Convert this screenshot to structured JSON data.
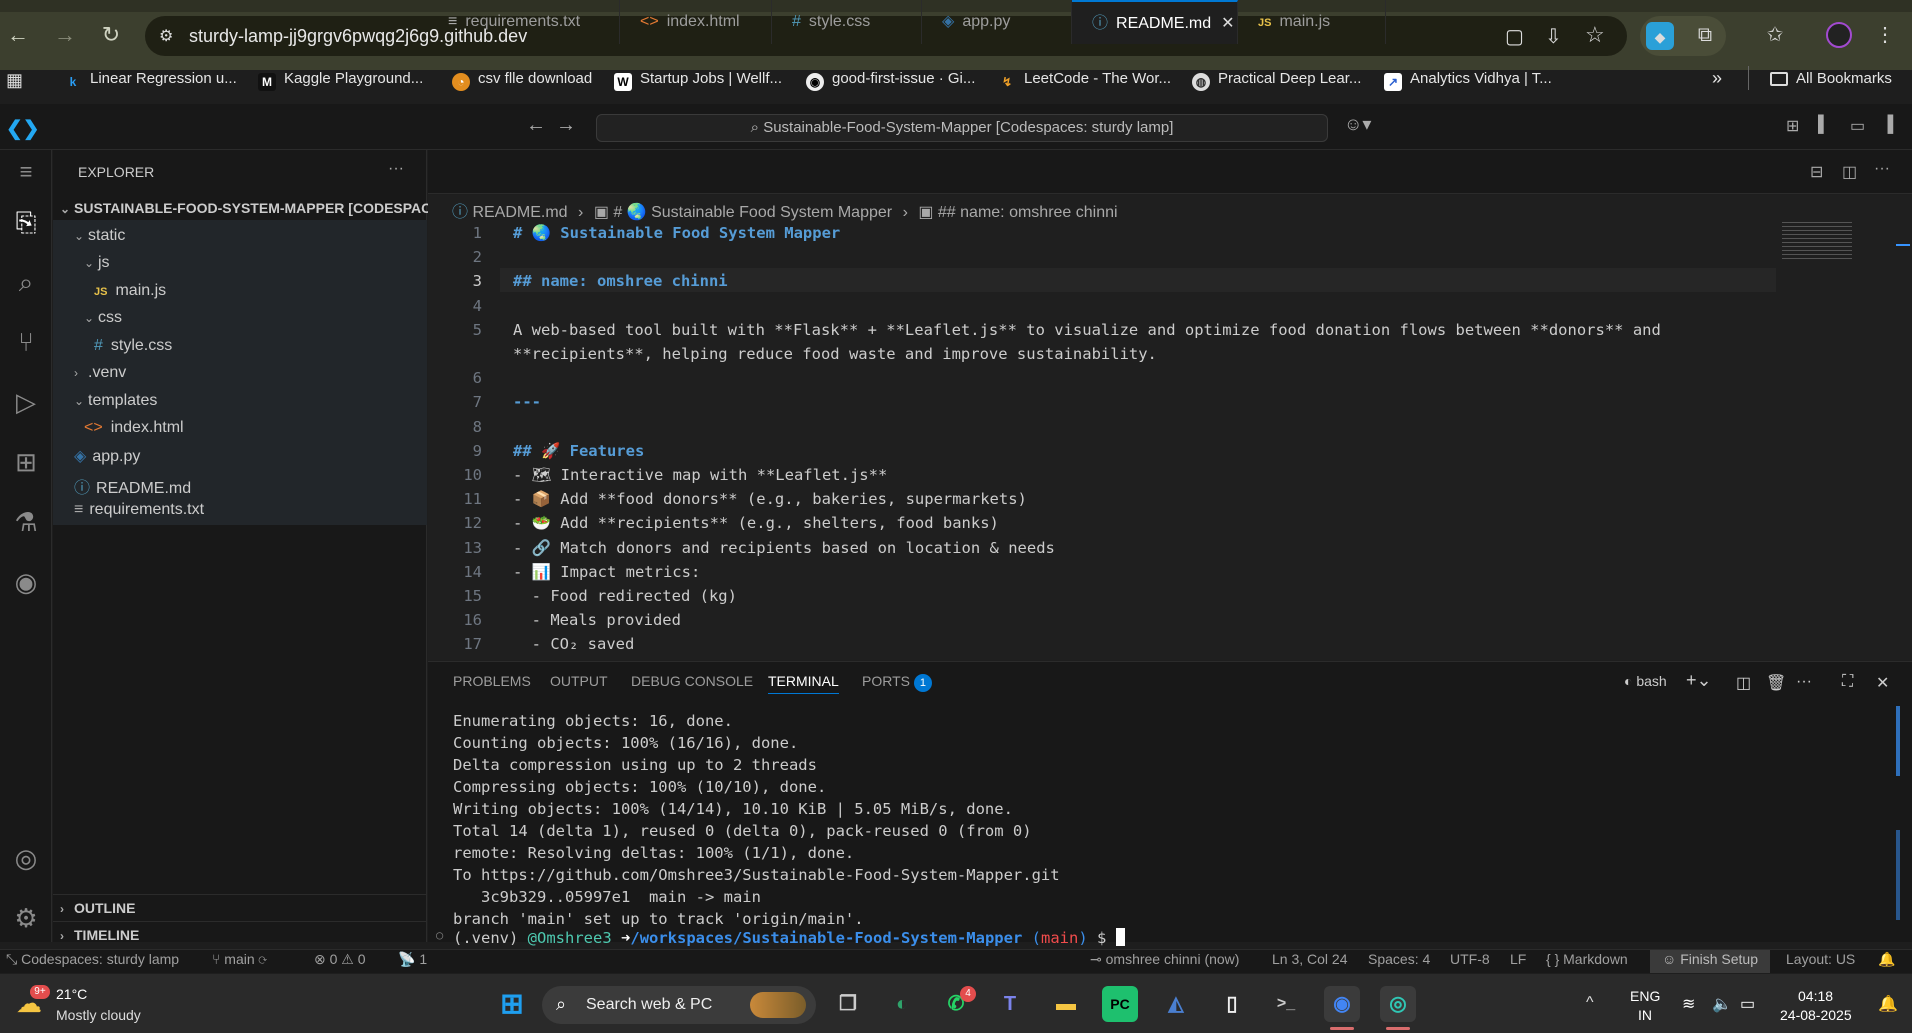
{
  "browser": {
    "url": "sturdy-lamp-jj9grgv6pwqg2j6g9.github.dev",
    "bookmarks": [
      {
        "label": "Linear Regression u...",
        "icon": "k"
      },
      {
        "label": "Kaggle Playground...",
        "icon": "M"
      },
      {
        "label": "csv flle download",
        "icon": "o"
      },
      {
        "label": "Startup Jobs | Wellf...",
        "icon": "W"
      },
      {
        "label": "good-first-issue · Gi...",
        "icon": "gh"
      },
      {
        "label": "LeetCode - The Wor...",
        "icon": "lc"
      },
      {
        "label": "Practical Deep Lear...",
        "icon": "pd"
      },
      {
        "label": "Analytics Vidhya | T...",
        "icon": "av"
      }
    ],
    "more_label": "»",
    "all_bookmarks": "All Bookmarks"
  },
  "vscode": {
    "command_center": "Sustainable-Food-System-Mapper [Codespaces: sturdy lamp]",
    "explorer": {
      "title": "EXPLORER",
      "root": "SUSTAINABLE-FOOD-SYSTEM-MAPPER [CODESPAC...",
      "items": [
        "static",
        "js",
        "main.js",
        "css",
        "style.css",
        ".venv",
        "templates",
        "index.html",
        "app.py",
        "README.md",
        "requirements.txt"
      ],
      "outline": "OUTLINE",
      "timeline": "TIMELINE"
    },
    "tabs": [
      "requirements.txt",
      "index.html",
      "style.css",
      "app.py",
      "README.md",
      "main.js"
    ],
    "breadcrumb": [
      "README.md",
      "# 🌏 Sustainable Food System Mapper",
      "## name: omshree chinni"
    ],
    "line_numbers": [
      "1",
      "2",
      "3",
      "4",
      "5",
      "",
      "6",
      "7",
      "8",
      "9",
      "10",
      "11",
      "12",
      "13",
      "14",
      "15",
      "16",
      "17"
    ],
    "code_lines": [
      "# 🌏 Sustainable Food System Mapper",
      "",
      "## name: omshree chinni",
      "",
      "A web-based tool built with **Flask** + **Leaflet.js** to visualize and optimize food donation flows between **donors** and",
      "**recipients**, helping reduce food waste and improve sustainability.",
      "",
      "---",
      "",
      "## 🚀 Features",
      "- 🗺 Interactive map with **Leaflet.js**",
      "- 📦 Add **food donors** (e.g., bakeries, supermarkets)",
      "- 🥗 Add **recipients** (e.g., shelters, food banks)",
      "- 🔗 Match donors and recipients based on location & needs",
      "- 📊 Impact metrics:",
      "  - Food redirected (kg)",
      "  - Meals provided",
      "  - CO₂ saved"
    ],
    "panel_tabs": [
      "PROBLEMS",
      "OUTPUT",
      "DEBUG CONSOLE",
      "TERMINAL",
      "PORTS"
    ],
    "ports_badge": "1",
    "terminal_shell": "bash",
    "terminal_lines": [
      "Enumerating objects: 16, done.",
      "Counting objects: 100% (16/16), done.",
      "Delta compression using up to 2 threads",
      "Compressing objects: 100% (10/10), done.",
      "Writing objects: 100% (14/14), 10.10 KiB | 5.05 MiB/s, done.",
      "Total 14 (delta 1), reused 0 (delta 0), pack-reused 0 (from 0)",
      "remote: Resolving deltas: 100% (1/1), done.",
      "To https://github.com/Omshree3/Sustainable-Food-System-Mapper.git",
      "   3c9b329..05997e1  main -> main",
      "branch 'main' set up to track 'origin/main'."
    ],
    "prompt": {
      "venv": "(.venv)",
      "user": "@Omshree3",
      "arrow": "➜",
      "path": "/workspaces/Sustainable-Food-System-Mapper",
      "branch_open": "(",
      "branch": "main",
      "branch_close": ")",
      "dollar": "$"
    },
    "status": {
      "remote": "Codespaces: sturdy lamp",
      "branch": "main",
      "errors": "0",
      "warnings": "0",
      "ports": "1",
      "author": "omshree chinni (now)",
      "position": "Ln 3, Col 24",
      "spaces": "Spaces: 4",
      "encoding": "UTF-8",
      "eol": "LF",
      "language": "Markdown",
      "finish_setup": "Finish Setup",
      "layout": "Layout: US"
    }
  },
  "taskbar": {
    "weather_temp": "21°C",
    "weather_desc": "Mostly cloudy",
    "weather_badge": "9+",
    "search": "Search web & PC",
    "whatsapp_badge": "4",
    "lang1": "ENG",
    "lang2": "IN",
    "time": "04:18",
    "date": "24-08-2025"
  }
}
